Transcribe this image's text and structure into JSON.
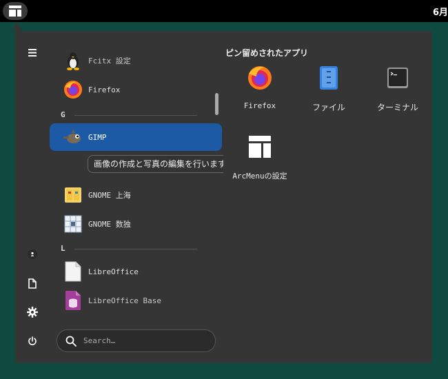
{
  "topbar": {
    "clock": "6月",
    "activities_icon": "layout-icon"
  },
  "sidebar": {
    "icons": [
      "menu-icon",
      "user-icon",
      "document-icon",
      "gear-icon",
      "power-icon"
    ]
  },
  "app_list": {
    "items": [
      {
        "label": "Fcitx 設定",
        "icon": "fcitx-penguin-icon"
      },
      {
        "label": "Firefox",
        "icon": "firefox-icon"
      },
      {
        "label": "GIMP",
        "icon": "gimp-icon",
        "selected": true
      },
      {
        "label": "GNOME 上海",
        "icon": "mahjongg-icon"
      },
      {
        "label": "GNOME 数独",
        "icon": "sudoku-icon"
      },
      {
        "label": "LibreOffice",
        "icon": "libreoffice-icon"
      },
      {
        "label": "LibreOffice Base",
        "icon": "libreoffice-base-icon"
      }
    ],
    "sections": [
      "G",
      "L"
    ],
    "tooltip": "画像の作成と写真の編集を行います"
  },
  "search": {
    "placeholder": "Search…"
  },
  "pinned": {
    "title": "ピン留めされたアプリ",
    "apps": [
      {
        "label": "Firefox",
        "icon": "firefox-icon"
      },
      {
        "label": "ファイル",
        "icon": "files-icon"
      },
      {
        "label": "ターミナル",
        "icon": "terminal-icon"
      },
      {
        "label": "ArcMenuの設定",
        "icon": "arcmenu-settings-icon"
      }
    ]
  }
}
